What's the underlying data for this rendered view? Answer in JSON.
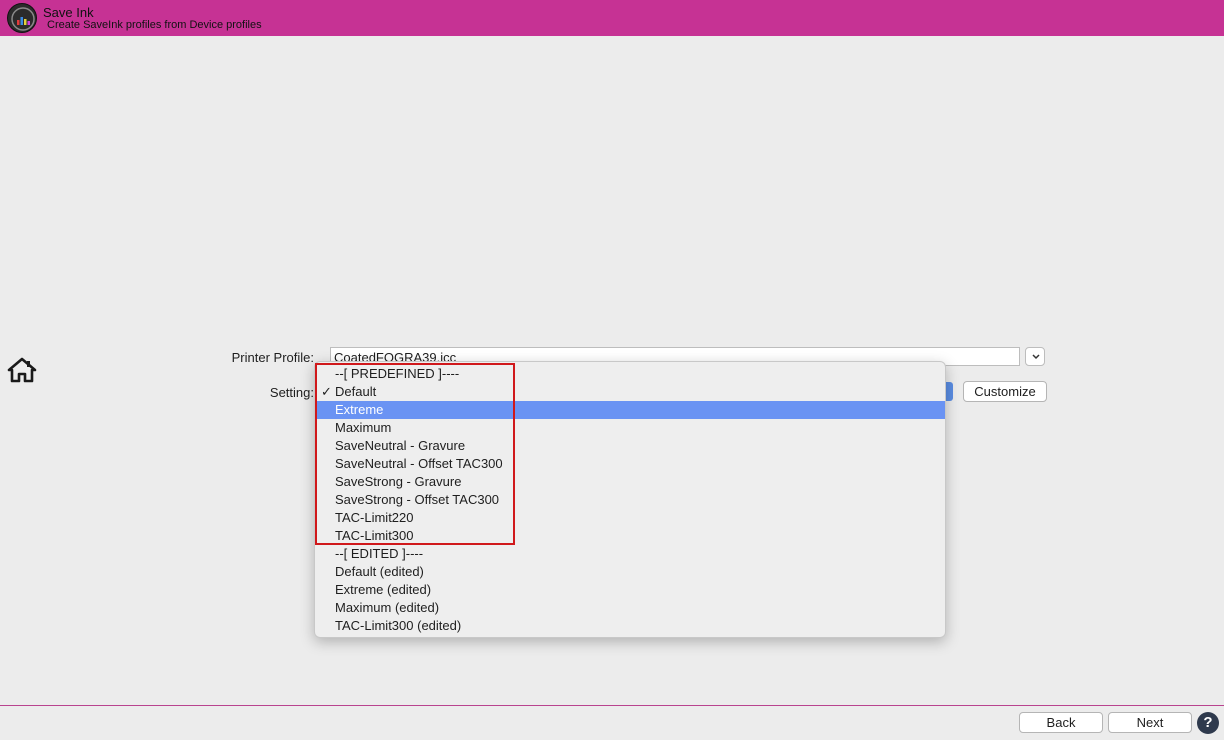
{
  "app": {
    "title": "Save Ink",
    "subtitle": "Create SaveInk profiles from Device profiles",
    "brand_color": "#c63294"
  },
  "form": {
    "printer_profile_label": "Printer Profile:",
    "printer_profile_value": "CoatedFOGRA39.icc",
    "setting_label": "Setting:",
    "customize_label": "Customize"
  },
  "setting_menu": {
    "selected": "Default",
    "highlighted": "Extreme",
    "items": [
      {
        "label": "--[ PREDEFINED ]----",
        "kind": "header"
      },
      {
        "label": "Default",
        "checked": true
      },
      {
        "label": "Extreme",
        "highlighted": true
      },
      {
        "label": "Maximum"
      },
      {
        "label": "SaveNeutral - Gravure"
      },
      {
        "label": "SaveNeutral - Offset TAC300"
      },
      {
        "label": "SaveStrong - Gravure"
      },
      {
        "label": "SaveStrong - Offset TAC300"
      },
      {
        "label": "TAC-Limit220"
      },
      {
        "label": "TAC-Limit300"
      },
      {
        "label": "--[ EDITED ]----",
        "kind": "header"
      },
      {
        "label": "Default (edited)"
      },
      {
        "label": "Extreme (edited)"
      },
      {
        "label": "Maximum (edited)"
      },
      {
        "label": "TAC-Limit300 (edited)"
      }
    ],
    "highlight_color": "#6a93f3",
    "annotation_box_color": "#d0181b"
  },
  "footer": {
    "back_label": "Back",
    "next_label": "Next",
    "help_label": "?"
  },
  "icons": {
    "app": "save-ink-app-icon",
    "home": "home-icon",
    "dropdown": "chevron-down-icon",
    "help": "help-icon",
    "check": "checkmark-icon"
  }
}
